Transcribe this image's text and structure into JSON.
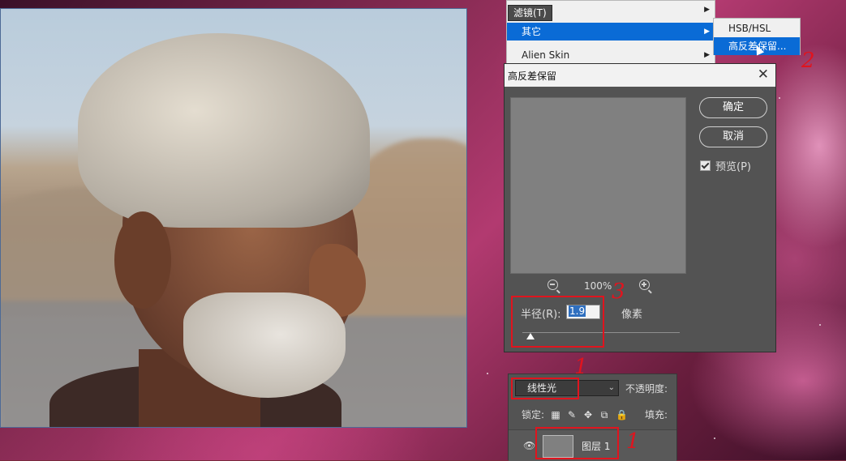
{
  "menu": {
    "header": "滤镜(T)",
    "items": [
      {
        "label": "",
        "has_submenu": true
      },
      {
        "label": "其它",
        "has_submenu": true,
        "active": true
      },
      {
        "label": "Alien Skin",
        "has_submenu": true
      }
    ],
    "submenu": [
      {
        "label": "HSB/HSL"
      },
      {
        "label": "高反差保留...",
        "active": true
      }
    ]
  },
  "dialog": {
    "title": "高反差保留",
    "close_glyph": "✕",
    "ok_label": "确定",
    "cancel_label": "取消",
    "preview_label": "预览(P)",
    "preview_checked": true,
    "zoom_percent": "100%",
    "radius_label": "半径(R):",
    "radius_value": "1.9",
    "radius_unit": "像素",
    "radius_slider_fraction": 0.05
  },
  "layers": {
    "blend_mode": "线性光",
    "opacity_label": "不透明度:",
    "lock_label": "锁定:",
    "fill_label": "填充:",
    "layer_name": "图层 1",
    "eye_glyph": "👁"
  },
  "annotations": [
    "1",
    "2",
    "3",
    "1"
  ],
  "colors": {
    "annotation": "#e0141e",
    "menu_highlight": "#0a6bd6",
    "dialog_bg": "#535353"
  },
  "icons": [
    "zoom-out-icon",
    "zoom-in-icon",
    "checkbox-icon",
    "lock-transparency-icon",
    "lock-brush-icon",
    "lock-move-icon",
    "lock-artboard-icon",
    "lock-all-icon",
    "eye-icon",
    "close-icon"
  ]
}
